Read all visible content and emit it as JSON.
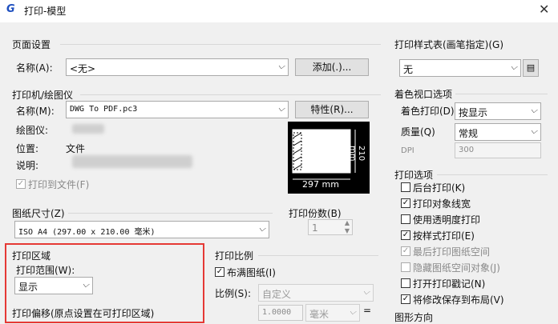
{
  "window": {
    "title": "打印-模型",
    "icon": "app-g-icon",
    "close": "✕"
  },
  "page_setup": {
    "group": "页面设置",
    "name_label": "名称(A):",
    "name_value": "<无>",
    "add_button": "添加(.)..."
  },
  "plotter": {
    "group": "打印机/绘图仪",
    "name_label": "名称(M):",
    "name_value": "DWG To PDF.pc3",
    "properties_button": "特性(R)...",
    "plotter_label": "绘图仪:",
    "location_label": "位置:",
    "location_value": "文件",
    "description_label": "说明:",
    "print_to_file": "打印到文件(F)"
  },
  "preview": {
    "width_dim": "297 mm",
    "height_dim": "210 mm"
  },
  "paper": {
    "group": "图纸尺寸(Z)",
    "value": "ISO A4 (297.00 x 210.00 毫米)"
  },
  "copies": {
    "label": "打印份数(B)",
    "value": "1"
  },
  "plot_area": {
    "group": "打印区域",
    "range_label": "打印范围(W):",
    "range_value": "显示"
  },
  "plot_offset": {
    "group": "打印偏移(原点设置在可打印区域)"
  },
  "plot_scale": {
    "group": "打印比例",
    "fit_paper": "布满图纸(I)",
    "scale_label": "比例(S):",
    "scale_value": "自定义",
    "scale_num": "1.0000",
    "unit": "毫米",
    "equals": "="
  },
  "style_table": {
    "group": "打印样式表(画笔指定)(G)",
    "value": "无"
  },
  "shaded_viewport": {
    "group": "着色视口选项",
    "shade_label": "着色打印(D)",
    "shade_value": "按显示",
    "quality_label": "质量(Q)",
    "quality_value": "常规",
    "dpi_label": "DPI",
    "dpi_value": "300"
  },
  "plot_options": {
    "group": "打印选项",
    "items": [
      {
        "label": "后台打印(K)",
        "checked": false,
        "enabled": true
      },
      {
        "label": "打印对象线宽",
        "checked": true,
        "enabled": true
      },
      {
        "label": "使用透明度打印",
        "checked": false,
        "enabled": true
      },
      {
        "label": "按样式打印(E)",
        "checked": true,
        "enabled": true
      },
      {
        "label": "最后打印图纸空间",
        "checked": true,
        "enabled": false
      },
      {
        "label": "隐藏图纸空间对象(J)",
        "checked": false,
        "enabled": false
      },
      {
        "label": "打开打印戳记(N)",
        "checked": false,
        "enabled": true
      },
      {
        "label": "将修改保存到布局(V)",
        "checked": true,
        "enabled": true
      }
    ]
  },
  "orientation": {
    "group": "图形方向"
  }
}
